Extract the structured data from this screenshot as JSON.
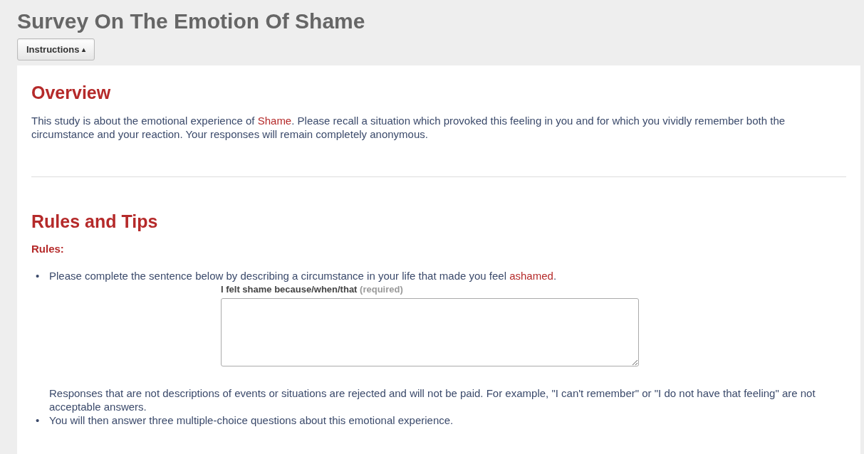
{
  "title": "Survey On The Emotion Of Shame",
  "instructions_button": {
    "label": "Instructions",
    "caret": "▴",
    "expanded": true
  },
  "overview": {
    "heading": "Overview",
    "text": {
      "before": "This study is about the emotional experience of ",
      "highlight": "Shame",
      "after": ". Please recall a situation which provoked this feeling in you and for which you vividly remember both the circumstance and your reaction. Your responses will remain completely anonymous."
    }
  },
  "rules_tips": {
    "heading": "Rules and Tips",
    "subheading": "Rules:",
    "items": [
      {
        "bullet": "•",
        "text": {
          "before": "Please complete the sentence below by describing a circumstance in your life that made you feel ",
          "highlight": "ashamed",
          "after": "."
        },
        "field": {
          "label": "I felt shame because/when/that",
          "hint": "(required)"
        },
        "note": "Responses that are not descriptions of events or situations are rejected and will not be paid. For example, \"I can't remember\" or \"I do not have that feeling\" are not acceptable answers."
      },
      {
        "bullet": "•",
        "text": {
          "before": "You will then answer three multiple-choice questions about this emotional experience."
        }
      }
    ]
  }
}
